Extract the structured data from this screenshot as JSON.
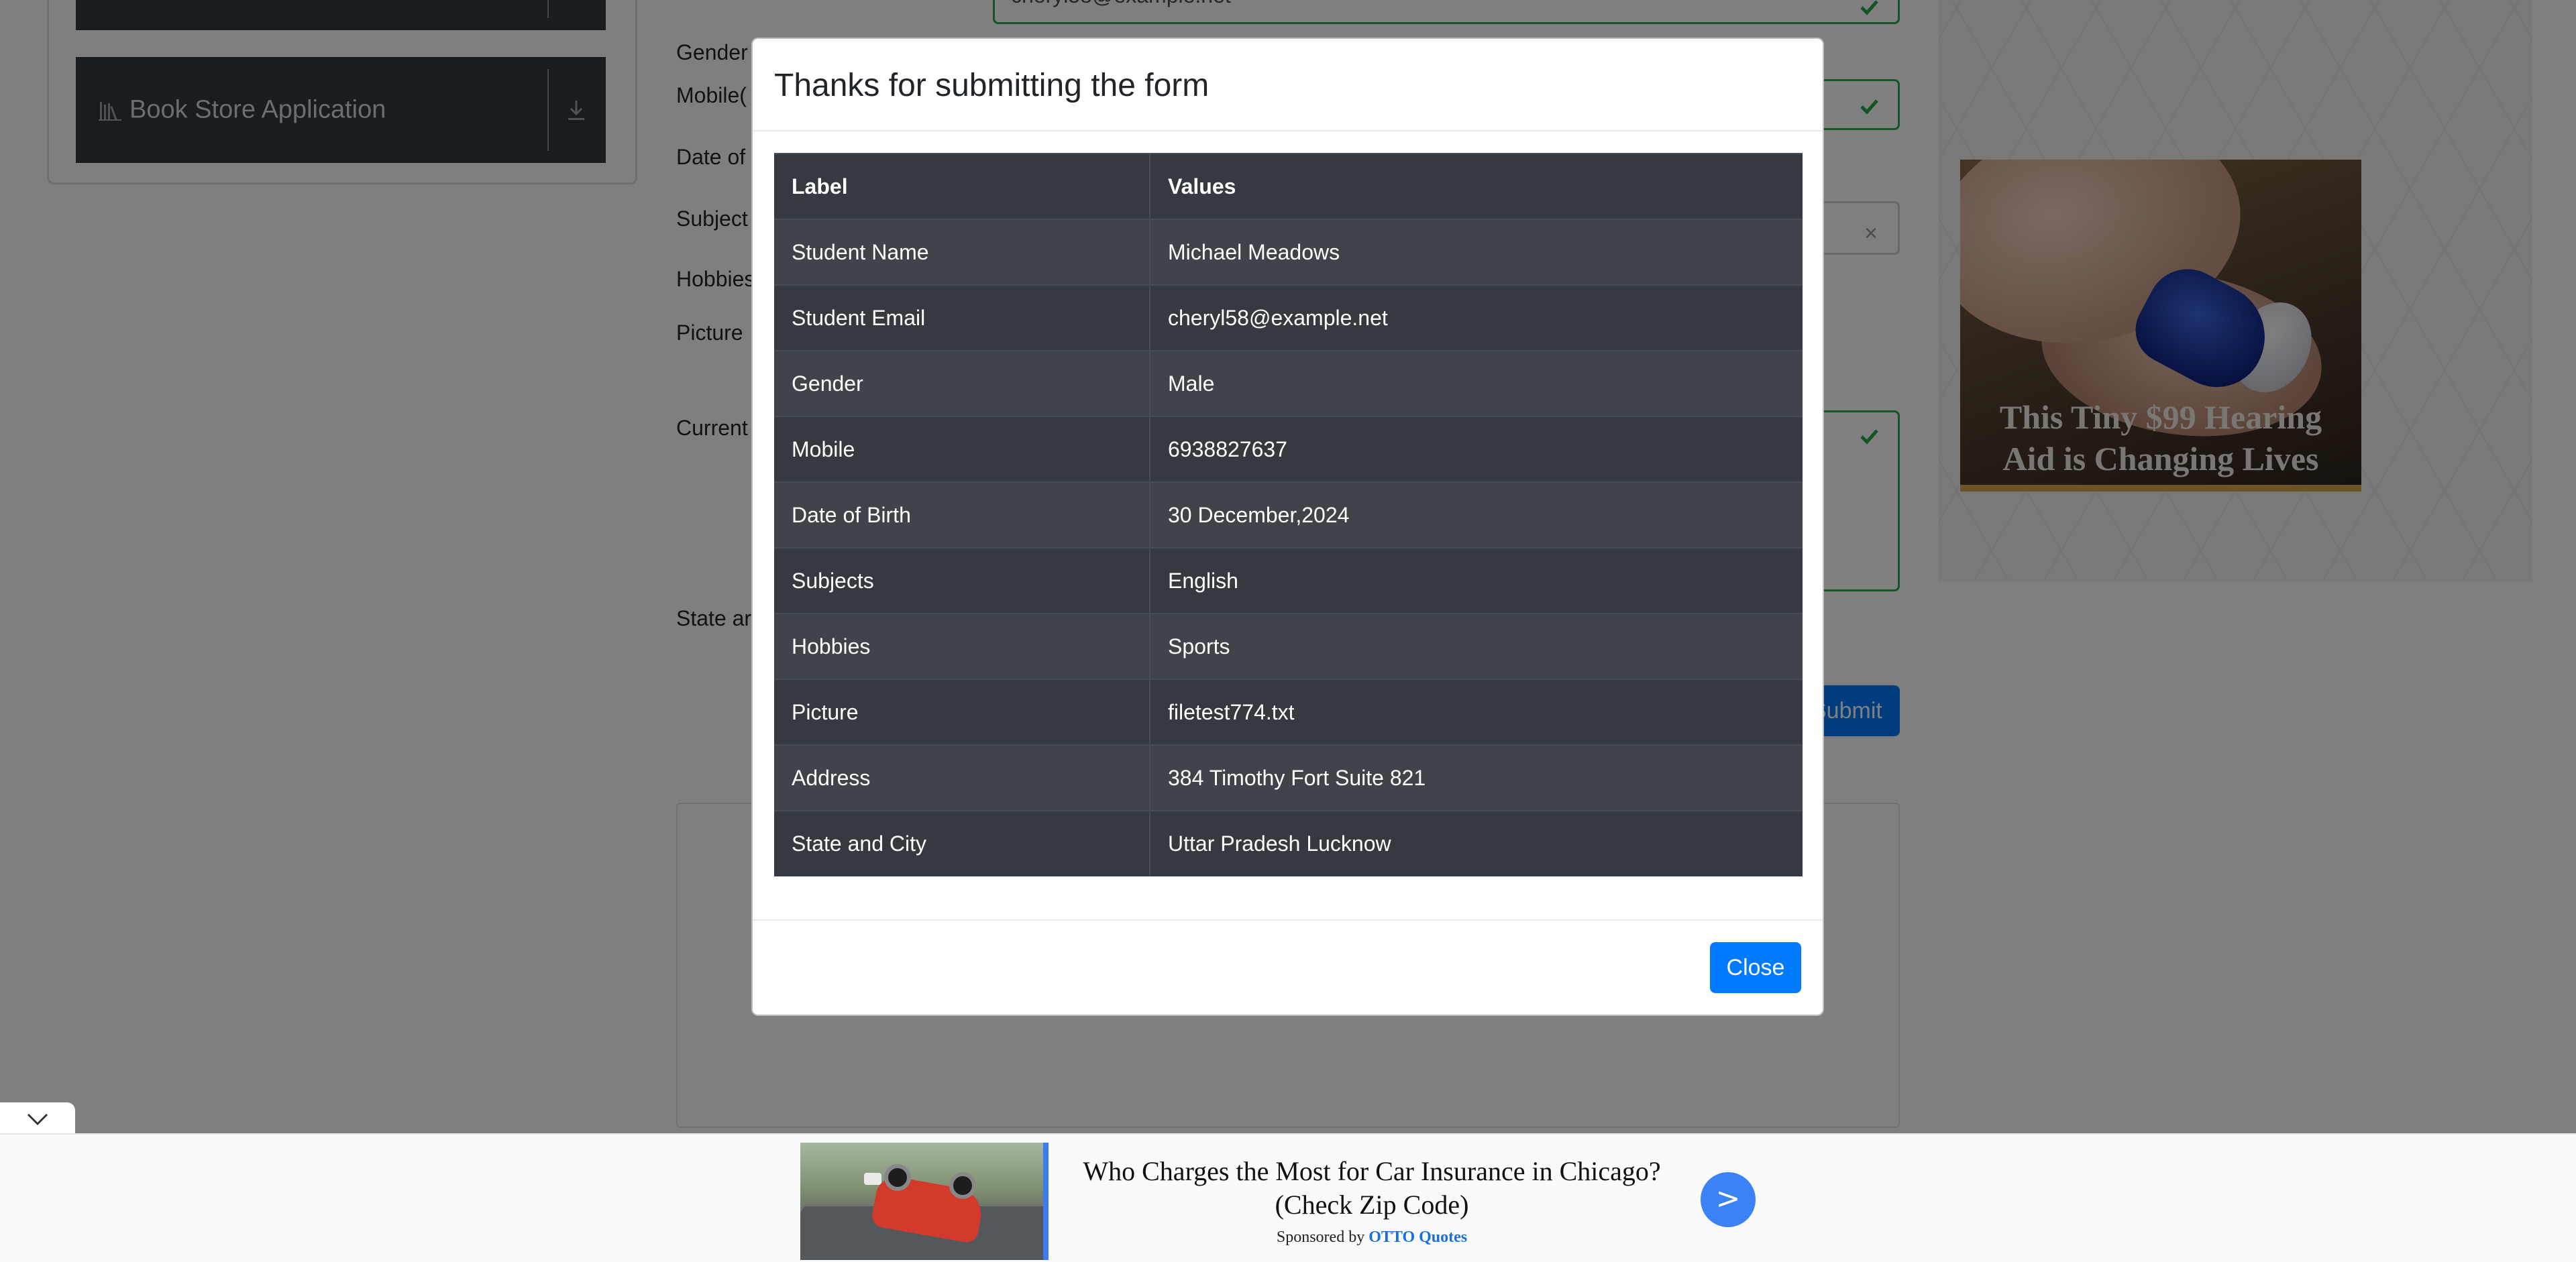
{
  "sidebar": {
    "items": [
      {
        "label": ""
      },
      {
        "label": "Book Store Application"
      }
    ]
  },
  "form": {
    "labels": {
      "gender": "Gender",
      "mobile": "Mobile(",
      "dob": "Date of",
      "subjects": "Subject",
      "hobbies": "Hobbies",
      "picture": "Picture",
      "current_address": "Current",
      "state_city": "State ar"
    },
    "email_value": "cheryl58@example.net",
    "subjects_clear": "×",
    "submit_label": "Submit"
  },
  "right_ad": {
    "headline": "This Tiny $99 Hearing Aid is Changing Lives"
  },
  "modal": {
    "title": "Thanks for submitting the form",
    "columns": [
      "Label",
      "Values"
    ],
    "rows": [
      {
        "label": "Student Name",
        "value": "Michael Meadows"
      },
      {
        "label": "Student Email",
        "value": "cheryl58@example.net"
      },
      {
        "label": "Gender",
        "value": "Male"
      },
      {
        "label": "Mobile",
        "value": "6938827637"
      },
      {
        "label": "Date of Birth",
        "value": "30 December,2024"
      },
      {
        "label": "Subjects",
        "value": "English"
      },
      {
        "label": "Hobbies",
        "value": "Sports"
      },
      {
        "label": "Picture",
        "value": "filetest774.txt"
      },
      {
        "label": "Address",
        "value": "384 Timothy Fort Suite 821"
      },
      {
        "label": "State and City",
        "value": "Uttar Pradesh Lucknow"
      }
    ],
    "close_label": "Close"
  },
  "bottom_ad": {
    "headline": "Who Charges the Most for Car Insurance in Chicago? (Check Zip Code)",
    "sponsor_prefix": "Sponsored by",
    "sponsor_brand": "OTTO Quotes",
    "cta": ">"
  },
  "colors": {
    "primary": "#007bff",
    "table_dark": "#343a40",
    "valid_green": "#28a745",
    "backdrop": "rgba(0,0,0,0.5)"
  }
}
